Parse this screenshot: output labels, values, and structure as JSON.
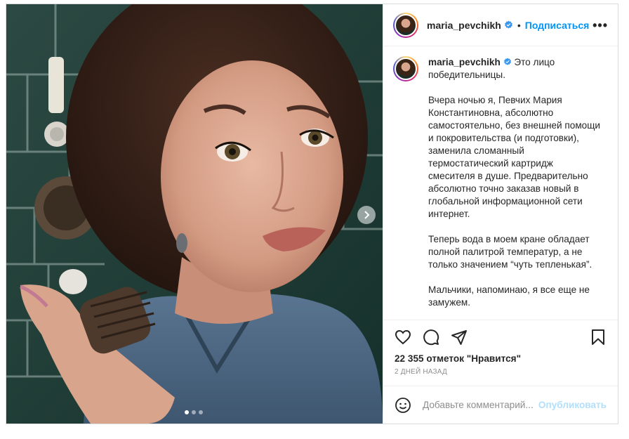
{
  "post": {
    "username": "maria_pevchikh",
    "separator": "•",
    "follow_label": "Подписаться",
    "more_label": "•••",
    "caption": {
      "username": "maria_pevchikh",
      "first": "Это лицо победительницы.",
      "p2": "Вчера ночью я, Певчих Мария Константиновна, абсолютно самостоятельно, без внешней помощи и покровительства (и подготовки), заменила сломанный термостатический картридж смесителя в душе. Предварительно абсолютно точно заказав новый в глобальной информационной сети интернет.",
      "p3": "Теперь вода в моем кране обладает полной палитрой температур, а не только значением “чуть тепленькая”.",
      "p4": "Мальчики, напоминаю, я все еще не замужем."
    },
    "likes": "22 355 отметок \"Нравится\"",
    "timestamp": "2 дней назад",
    "comment_placeholder": "Добавьте комментарий...",
    "publish_label": "Опубликовать",
    "carousel": {
      "count": 3,
      "active": 0
    }
  },
  "colors": {
    "accent": "#0095f6",
    "publish_disabled": "#b2dffc",
    "verified": "#3897f0"
  },
  "icons": [
    "verified-icon",
    "heart-icon",
    "comment-icon",
    "share-icon",
    "bookmark-icon",
    "emoji-icon",
    "chevron-right-icon"
  ]
}
